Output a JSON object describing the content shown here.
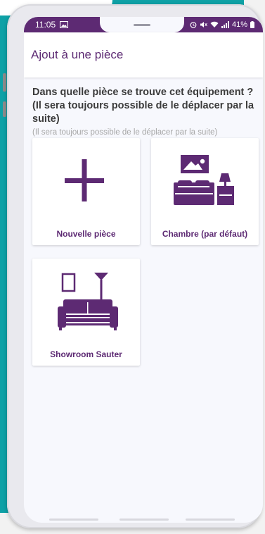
{
  "status_bar": {
    "time": "11:05",
    "battery": "41%",
    "icons": [
      "image-icon",
      "alarm-icon",
      "mute-icon",
      "wifi-icon",
      "signal-icon",
      "battery-icon"
    ]
  },
  "app_bar": {
    "title": "Ajout à une pièce"
  },
  "question": "Dans quelle pièce se trouve cet équipement ? (Il sera toujours possible de le déplacer par la suite)",
  "subtext": "(Il sera toujours possible de le déplacer par la suite)",
  "rooms": [
    {
      "label": "Nouvelle pièce",
      "icon": "plus-icon"
    },
    {
      "label": "Chambre (par défaut)",
      "icon": "bedroom-icon"
    },
    {
      "label": "Showroom Sauter",
      "icon": "livingroom-icon"
    }
  ],
  "colors": {
    "accent": "#5d2a73",
    "background": "#0ea1a6",
    "screen": "#f7f8fd"
  }
}
